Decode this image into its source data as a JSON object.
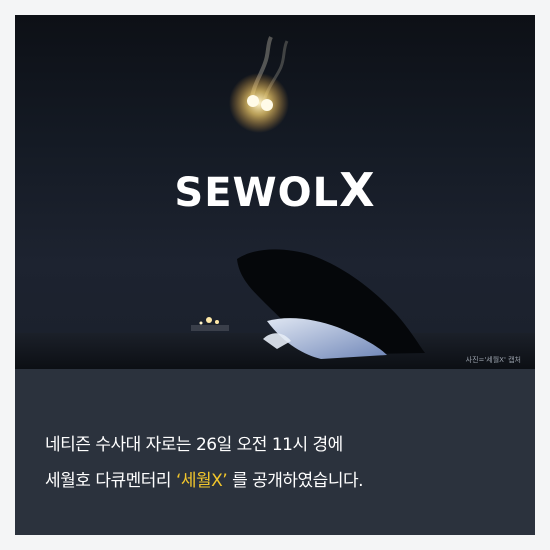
{
  "image": {
    "logo_text": "SEWOL",
    "logo_x": "X",
    "credit": "사진='세월X' 캡처"
  },
  "caption": {
    "line1": "네티즌 수사대 자로는 26일 오전 11시 경에",
    "line2_before": "세월호 다큐멘터리 ",
    "line2_highlight": "‘세월X’",
    "line2_after": " 를 공개하였습니다."
  },
  "colors": {
    "card_background": "#2b323d",
    "highlight": "#f2c62b",
    "page_background": "#f4f5f6"
  }
}
